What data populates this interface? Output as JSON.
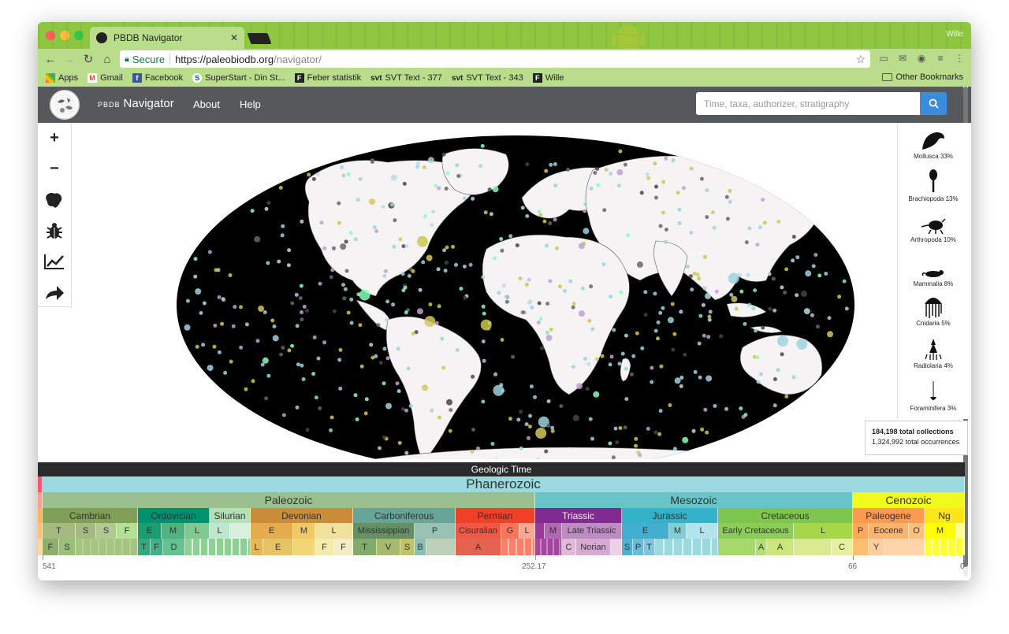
{
  "browser": {
    "tab_title": "PBDB Navigator",
    "tab_close": "✕",
    "profile_name": "Wille",
    "secure_label": "Secure",
    "url_host": "https://paleobiodb.org",
    "url_path": "/navigator/",
    "bookmarks": [
      {
        "label": "Apps",
        "icon": "apps-grid-icon"
      },
      {
        "label": "Gmail",
        "icon": "gmail-icon"
      },
      {
        "label": "Facebook",
        "icon": "facebook-icon"
      },
      {
        "label": "SuperStart - Din St...",
        "icon": "superstart-icon"
      },
      {
        "label": "Feber statistik",
        "icon": "feber-icon"
      },
      {
        "label": "SVT Text - 377",
        "icon": "svt-icon"
      },
      {
        "label": "SVT Text - 343",
        "icon": "svt-icon"
      },
      {
        "label": "Wille",
        "icon": "feber-icon"
      }
    ],
    "other_bookmarks": "Other Bookmarks"
  },
  "app": {
    "brand_small": "PBDB",
    "brand_main": "Navigator",
    "nav": [
      "About",
      "Help"
    ],
    "search_placeholder": "Time, taxa, authorizer, stratigraphy"
  },
  "tools": [
    "zoom-in-icon",
    "zoom-out-icon",
    "paleogeography-icon",
    "taxa-bug-icon",
    "diversity-chart-icon",
    "share-icon"
  ],
  "taxa": [
    {
      "label": "Mollusca 33%"
    },
    {
      "label": "Brachiopoda 13%"
    },
    {
      "label": "Arthropoda 10%"
    },
    {
      "label": "Mammalia 8%"
    },
    {
      "label": "Cnidaria 5%"
    },
    {
      "label": "Radiolaria 4%"
    },
    {
      "label": "Foraminifera 3%"
    }
  ],
  "summary": {
    "collections": "184,198",
    "collections_label": "total collections",
    "occurrences": "1,324,992",
    "occurrences_label": "total occurrences"
  },
  "geologic_time": {
    "header": "Geologic Time",
    "eon": "Phanerozoic",
    "eras": [
      "Paleozoic",
      "Mesozoic",
      "Cenozoic"
    ],
    "periods": [
      "Cambrian",
      "Ordovician",
      "Silurian",
      "Devonian",
      "Carboniferous",
      "Permian",
      "Triassic",
      "Jurassic",
      "Cretaceous",
      "Paleogene",
      "Ng"
    ],
    "epochs": [
      "T",
      "S",
      "S",
      "F",
      "E",
      "M",
      "L",
      "L",
      "E",
      "M",
      "L",
      "Mississippian",
      "P",
      "Cisuralian",
      "G",
      "L",
      "M",
      "Late Triassic",
      "E",
      "M",
      "L",
      "Early Cretaceous",
      "L",
      "P",
      "Eocene",
      "O",
      "M"
    ],
    "ages": [
      "F",
      "S",
      "T",
      "F",
      "D",
      "L",
      "E",
      "F",
      "F",
      "T",
      "V",
      "S",
      "B",
      "A",
      "C",
      "Norian",
      "S",
      "P",
      "T",
      "A",
      "A",
      "C",
      "Y"
    ],
    "axis": [
      "541",
      "252.17",
      "66",
      "0"
    ]
  },
  "colors": {
    "tabstrip": "#8ec63f",
    "navbar": "#55595c",
    "search_button": "#3a8dde",
    "paleozoic": "#99c08d",
    "mesozoic": "#67c5ca",
    "cenozoic": "#f2f91d"
  }
}
